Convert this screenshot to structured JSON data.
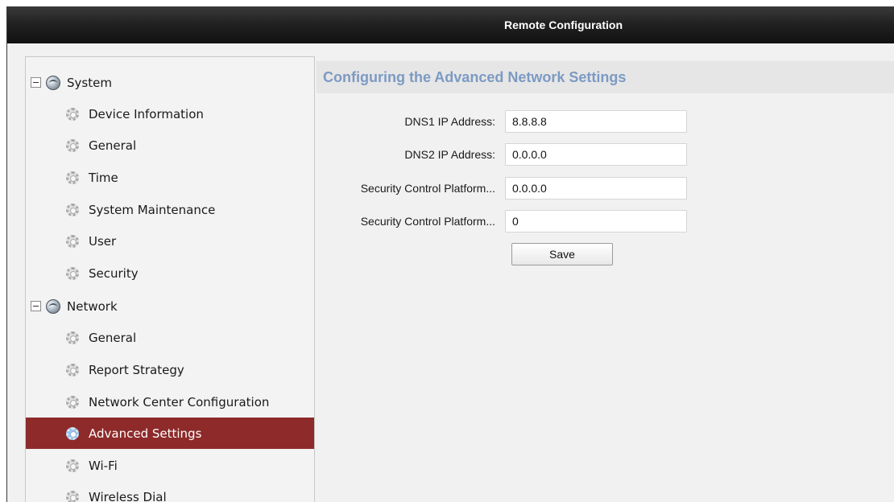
{
  "window": {
    "title": "Remote Configuration"
  },
  "sidebar": {
    "groups": [
      {
        "label": "System",
        "expander": "−",
        "icon": "globe-gear-icon",
        "items": [
          {
            "label": "Device Information",
            "icon": "gear-icon"
          },
          {
            "label": "General",
            "icon": "gear-icon"
          },
          {
            "label": "Time",
            "icon": "gear-icon"
          },
          {
            "label": "System Maintenance",
            "icon": "gear-icon"
          },
          {
            "label": "User",
            "icon": "gear-icon"
          },
          {
            "label": "Security",
            "icon": "gear-icon"
          }
        ]
      },
      {
        "label": "Network",
        "expander": "−",
        "icon": "globe-gear-icon",
        "items": [
          {
            "label": "General",
            "icon": "gear-icon"
          },
          {
            "label": "Report Strategy",
            "icon": "gear-icon"
          },
          {
            "label": "Network Center Configuration",
            "icon": "gear-icon"
          },
          {
            "label": "Advanced Settings",
            "icon": "gear-icon",
            "selected": true
          },
          {
            "label": "Wi-Fi",
            "icon": "gear-icon"
          },
          {
            "label": "Wireless Dial",
            "icon": "gear-icon"
          }
        ]
      }
    ],
    "selected_color": "#8e2a2a"
  },
  "main": {
    "heading": "Configuring the Advanced Network Settings",
    "heading_color": "#7c9ac3",
    "fields": [
      {
        "label": "DNS1 IP Address:",
        "value": "8.8.8.8"
      },
      {
        "label": "DNS2 IP Address:",
        "value": "0.0.0.0"
      },
      {
        "label": "Security Control Platform...",
        "value": "0.0.0.0"
      },
      {
        "label": "Security Control Platform...",
        "value": "0"
      }
    ],
    "save_label": "Save"
  }
}
